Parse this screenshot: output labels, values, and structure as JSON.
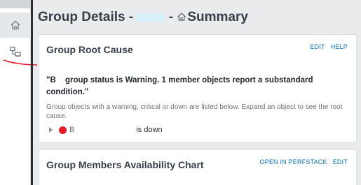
{
  "header": {
    "title_prefix": "Group Details - ",
    "title_redacted": "",
    "title_sep": " - ",
    "title_suffix": "Summary"
  },
  "root_cause": {
    "title": "Group Root Cause",
    "actions": [
      "EDIT",
      "HELP"
    ],
    "status_lead": "\"B",
    "status_text": " group status is Warning. 1 member objects report a substandard condition.\"",
    "description": "Group objects with a warning, critical or down are listed below. Expand an object to see the root cause.",
    "item": {
      "name": "B",
      "status": "is down",
      "status_color": "#e21b2a"
    }
  },
  "availability": {
    "title": "Group Members Availability Chart",
    "actions": [
      "OPEN IN PERFSTACK",
      "EDIT"
    ]
  },
  "icons": {
    "rail": [
      "home-icon",
      "group-nodes-icon"
    ]
  },
  "colors": {
    "accent": "#0a74b0",
    "title": "#37404a",
    "down": "#e21b2a"
  }
}
